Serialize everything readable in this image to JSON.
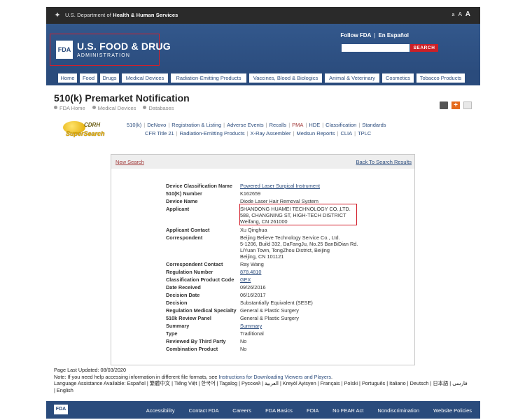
{
  "hhs": {
    "prefix": "U.S. Department of ",
    "bold": "Health & Human Services",
    "size_a1": "a",
    "size_a2": "A",
    "size_a3": "A"
  },
  "header": {
    "logo_box": "FDA",
    "title": "U.S. FOOD & DRUG",
    "subtitle": "ADMINISTRATION",
    "follow": "Follow FDA",
    "sep": "|",
    "espanol": "En Español",
    "search_button": "SEARCH",
    "search_placeholder": ""
  },
  "nav": [
    "Home",
    "Food",
    "Drugs",
    "Medical Devices",
    "Radiation-Emitting Products",
    "Vaccines, Blood & Biologics",
    "Animal & Veterinary",
    "Cosmetics",
    "Tobacco Products"
  ],
  "page": {
    "title": "510(k) Premarket Notification",
    "breadcrumbs": [
      "FDA Home",
      "Medical Devices",
      "Databases"
    ]
  },
  "cdrh": {
    "line1": "CDRH",
    "line2": "SuperSearch"
  },
  "db_links": {
    "row1": [
      "510(k)",
      "DeNovo",
      "Registration & Listing",
      "Adverse Events",
      "Recalls",
      "PMA",
      "HDE",
      "Classification",
      "Standards"
    ],
    "row2": [
      "CFR Title 21",
      "Radiation-Emitting Products",
      "X-Ray Assembler",
      "Medsun Reports",
      "CLIA",
      "TPLC"
    ],
    "separator": "|"
  },
  "results": {
    "new_search": "New Search",
    "back_link": "Back To Search Results",
    "fields": [
      {
        "label": "Device Classification Name",
        "value": "Powered Laser Surgical Instrument",
        "link": true
      },
      {
        "label": "510(K) Number",
        "value": "K162659",
        "link": false
      },
      {
        "label": "Device Name",
        "value": "Diode Laser Hair Removal System",
        "link": false
      },
      {
        "label": "Applicant",
        "lines": [
          "SHANDONG HUAMEI TECHNOLOGY CO.,LTD.",
          "588, CHANGNING ST, HIGH-TECH DISTRICT",
          "Weifang,  CN 261000"
        ]
      },
      {
        "label": "Applicant Contact",
        "value": "Xu Qinghua",
        "link": false
      },
      {
        "label": "Correspondent",
        "lines": [
          "Beijing Believe Technology Service Co., Ltd.",
          "5-1206, Build 332, DaFangJu, No.25 BanBiDian Rd.",
          "LiYuan Town, TongZhou District, Beijing",
          "Beijing,  CN 101121"
        ]
      },
      {
        "label": "Correspondent Contact",
        "value": "Ray Wang",
        "link": false
      },
      {
        "label": "Regulation Number",
        "value": "878.4810",
        "link": true
      },
      {
        "label": "Classification Product Code",
        "value": "GEX",
        "link": true
      },
      {
        "label": "Date Received",
        "value": "09/26/2016",
        "link": false
      },
      {
        "label": "Decision Date",
        "value": "06/16/2017",
        "link": false
      },
      {
        "label": "Decision",
        "value": "Substantially Equivalent (SESE)",
        "link": false
      },
      {
        "label": "Regulation Medical Specialty",
        "value": "General & Plastic Surgery",
        "link": false
      },
      {
        "label": "510k Review Panel",
        "value": "General & Plastic Surgery",
        "link": false
      },
      {
        "label": "Summary",
        "value": "Summary",
        "link": true
      },
      {
        "label": "Type",
        "value": "Traditional",
        "link": false
      },
      {
        "label": "Reviewed By Third Party",
        "value": "No",
        "link": false
      },
      {
        "label": "Combination Product",
        "value": "No",
        "link": false
      }
    ]
  },
  "footer": {
    "updated": "Page Last Updated: 08/03/2020",
    "note_prefix": "Note: If you need help accessing information in different file formats, see ",
    "note_link": "Instructions for Downloading Viewers and Players",
    "note_suffix": ".",
    "lang_line": "Language Assistance Available: Español | 繁體中文 | Tiếng Việt | 한국어 | Tagalog | Русский | العربية | Kreyòl Ayisyen | Français | Polski | Português | Italiano | Deutsch | 日本語 | فارسی",
    "english": "| English"
  },
  "bottom": {
    "logo": "FDA",
    "links": [
      "Accessibility",
      "Contact FDA",
      "Careers",
      "FDA Basics",
      "FOIA",
      "No FEAR Act",
      "Nondiscrimination",
      "Website Policies"
    ]
  },
  "colors": {
    "fda_blue": "#2a4b7c",
    "highlight_red": "#d21f2b",
    "search_red": "#cc2027"
  }
}
